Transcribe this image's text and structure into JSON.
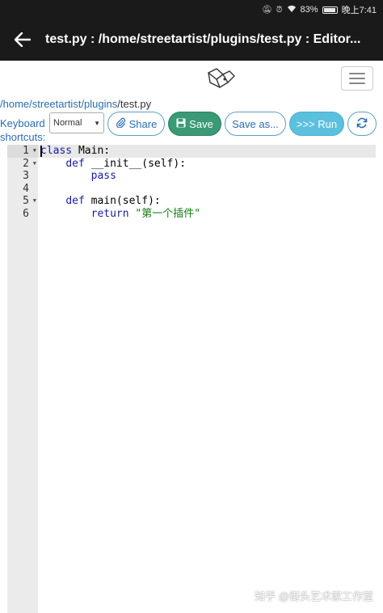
{
  "status_bar": {
    "icons": [
      "mute-icon",
      "alarm-icon",
      "wifi-icon"
    ],
    "battery_percent": "83%",
    "battery_level": 0.83,
    "time": "晚上7:41"
  },
  "app_bar": {
    "title": "test.py : /home/streetartist/plugins/test.py : Editor..."
  },
  "breadcrumb": {
    "part1": "/home",
    "part2": "/streetartist",
    "part3": "/plugins",
    "file": "/test.py"
  },
  "toolbar": {
    "keyboard_label": "Keyboard shortcuts:",
    "mode_value": "Normal",
    "share_label": "Share",
    "save_label": "Save",
    "save_as_label": "Save as...",
    "run_label": ">>> Run"
  },
  "editor": {
    "line_numbers": [
      "1",
      "2",
      "3",
      "4",
      "5",
      "6"
    ],
    "lines": [
      {
        "kw": "class",
        "rest": " Main:"
      },
      {
        "indent": "    ",
        "kw": "def",
        "rest": " __init__(self):"
      },
      {
        "indent": "        ",
        "kw": "pass",
        "rest": ""
      },
      {
        "indent": "",
        "kw": "",
        "rest": ""
      },
      {
        "indent": "    ",
        "kw": "def",
        "rest": " main(self):"
      },
      {
        "indent": "        ",
        "kw": "return",
        "rest": " ",
        "str": "\"第一个插件\""
      }
    ]
  },
  "watermark": "知乎 @街头艺术家工作室"
}
